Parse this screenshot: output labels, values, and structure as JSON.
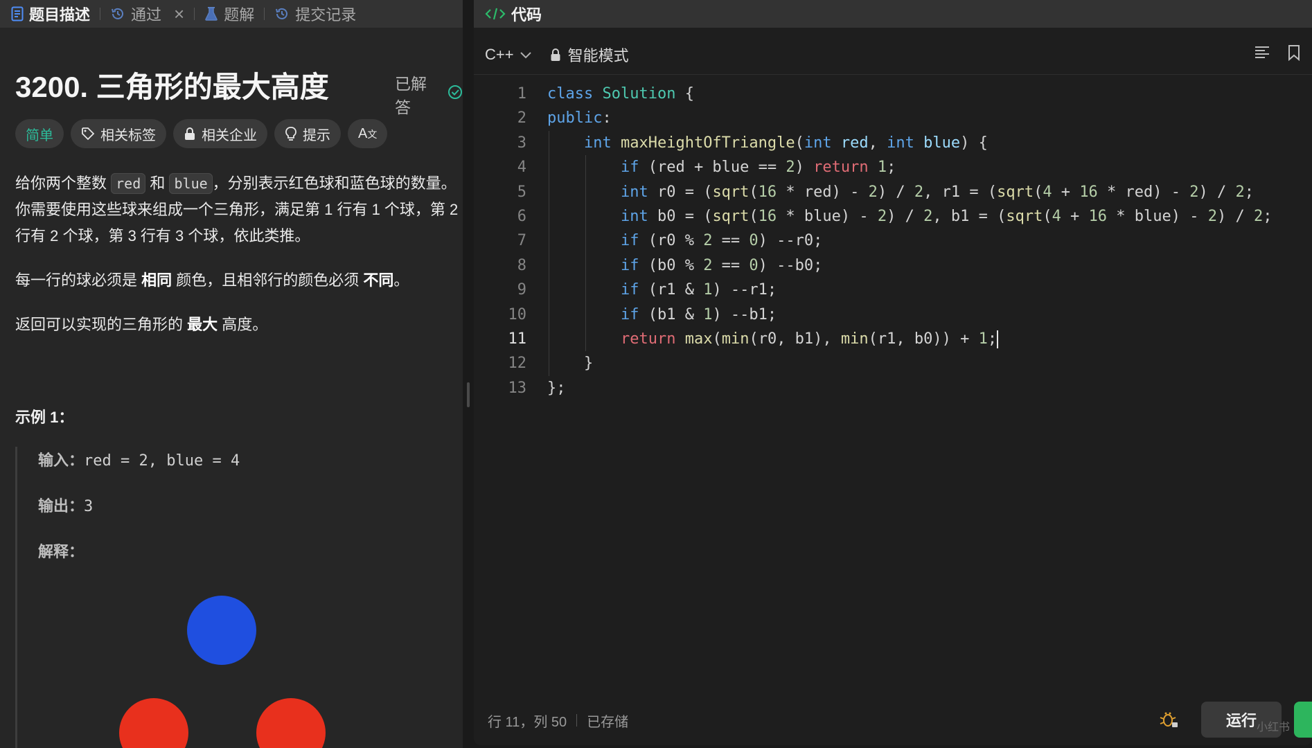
{
  "left_tabs": [
    {
      "label": "题目描述"
    },
    {
      "label": "通过"
    },
    {
      "label": "题解"
    },
    {
      "label": "提交记录"
    }
  ],
  "problem": {
    "title": "3200. 三角形的最大高度",
    "status": "已解答",
    "tags": [
      "简单",
      "相关标签",
      "相关企业",
      "提示"
    ],
    "desc": {
      "p1_a": "给你两个整数 ",
      "p1_code1": "red",
      "p1_b": " 和 ",
      "p1_code2": "blue",
      "p1_c": "，分别表示红色球和蓝色球的数量。你需要使用这些球来组成一个三角形，满足第 1 行有 1 个球，第 2 行有 2 个球，第 3 行有 3 个球，依此类推。",
      "p2_a": "每一行的球必须是 ",
      "p2_b": "相同",
      "p2_c": " 颜色，且相邻行的颜色必须 ",
      "p2_d": "不同",
      "p2_e": "。",
      "p3_a": "返回可以实现的三角形的 ",
      "p3_b": "最大",
      "p3_c": " 高度。"
    },
    "example": {
      "title": "示例 1：",
      "input_label": "输入：",
      "input_value": "red = 2, blue = 4",
      "output_label": "输出：",
      "output_value": "3",
      "explain_label": "解释：",
      "ball_colors": {
        "blue": "#1f4fe0",
        "red": "#e8301d"
      }
    }
  },
  "editor": {
    "tab_label": "代码",
    "language": "C++",
    "mode": "智能模式",
    "current_line": 11,
    "lines": [
      "class Solution {",
      "public:",
      "    int maxHeightOfTriangle(int red, int blue) {",
      "        if (red + blue == 2) return 1;",
      "        int r0 = (sqrt(16 * red) - 2) / 2, r1 = (sqrt(4 + 16 * red) - 2) / 2;",
      "        int b0 = (sqrt(16 * blue) - 2) / 2, b1 = (sqrt(4 + 16 * blue) - 2) / 2;",
      "        if (r0 % 2 == 0) --r0;",
      "        if (b0 % 2 == 0) --b0;",
      "        if (r1 & 1) --r1;",
      "        if (b1 & 1) --b1;",
      "        return max(min(r0, b1), min(r1, b0)) + 1;",
      "    }",
      "};"
    ]
  },
  "status": {
    "position": "行 11，列 50",
    "saved": "已存储",
    "run_label": "运行",
    "watermark": "小红书"
  },
  "colors": {
    "accent_green": "#2cbb9a",
    "submit_green": "#2db55d"
  }
}
